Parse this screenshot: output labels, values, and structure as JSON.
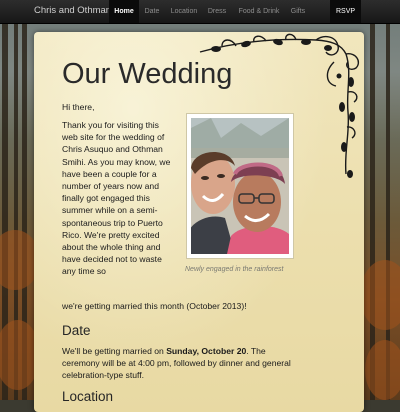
{
  "navbar": {
    "brand": "Chris and Othman",
    "items": [
      {
        "label": "Home",
        "active": true
      },
      {
        "label": "Date",
        "active": false
      },
      {
        "label": "Location",
        "active": false
      },
      {
        "label": "Dress",
        "active": false
      },
      {
        "label": "Food & Drink",
        "active": false
      },
      {
        "label": "Gifts",
        "active": false
      }
    ],
    "rsvp": "RSVP"
  },
  "page": {
    "title": "Our Wedding",
    "greeting": "Hi there,",
    "intro_wrapped": "Thank you for visiting this web site for the wedding of Chris Asuquo and Othman Smihi. As you may know, we have been a couple for a number of years now and finally got engaged this summer while on a semi-spontaneous trip to Puerto Rico. We're pretty excited about the whole thing and have decided not to waste any time so",
    "intro_tail": "we're getting married this month (October 2013)!",
    "photo_caption": "Newly engaged in the rainforest",
    "date_heading": "Date",
    "date_text_1": "We'll be getting married on ",
    "date_text_bold": "Sunday, October 20",
    "date_text_2": ". The ceremony will be at 4:00 pm, followed by dinner and general celebration-type stuff.",
    "location_heading": "Location"
  },
  "colors": {
    "navbar": "#1f1f1f",
    "panel": "#efe3b4",
    "text": "#1b1b1b",
    "caption": "#7a7a72"
  }
}
